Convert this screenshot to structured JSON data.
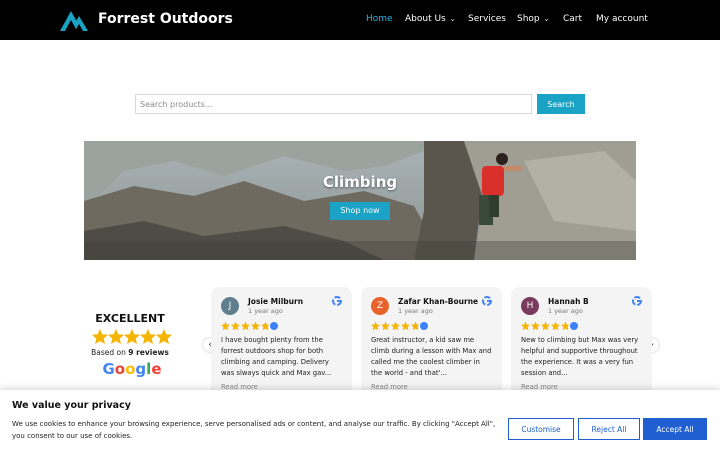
{
  "header": {
    "brand": "Forrest Outdoors",
    "nav": [
      {
        "label": "Home",
        "active": true,
        "dropdown": false
      },
      {
        "label": "About Us",
        "active": false,
        "dropdown": true
      },
      {
        "label": "Services",
        "active": false,
        "dropdown": false
      },
      {
        "label": "Shop",
        "active": false,
        "dropdown": true
      },
      {
        "label": "Cart",
        "active": false,
        "dropdown": false
      },
      {
        "label": "My account",
        "active": false,
        "dropdown": false
      }
    ]
  },
  "search": {
    "placeholder": "Search products...",
    "button_label": "Search"
  },
  "hero": {
    "title": "Climbing",
    "button_label": "Shop now"
  },
  "reviews_summary": {
    "rating_word": "EXCELLENT",
    "stars": 5,
    "based_on_prefix": "Based on",
    "review_count_label": "9 reviews",
    "provider": "Google"
  },
  "reviews": [
    {
      "name": "Josie Milburn",
      "initial": "J",
      "avatar_color": "#5f7f8f",
      "time": "1 year ago",
      "stars": 5,
      "text": "I have bought plenty from the forrest outdoors shop for both climbing and camping. Delivery was slways quick and Max gav...",
      "read_more": "Read more"
    },
    {
      "name": "Zafar Khan-Bourne",
      "initial": "Z",
      "avatar_color": "#e8622c",
      "time": "1 year ago",
      "stars": 5,
      "text": "Great instructor, a kid saw me climb during a lesson with Max and called me the coolest climber in the world - and that'...",
      "read_more": "Read more"
    },
    {
      "name": "Hannah B",
      "initial": "H",
      "avatar_color": "#7a3b5e",
      "time": "1 year ago",
      "stars": 5,
      "text": "New to climbing but Max was very helpful and supportive throughout the experience. It was a very fun session and...",
      "read_more": "Read more"
    }
  ],
  "cookie": {
    "title": "We value your privacy",
    "text": "We use cookies to enhance your browsing experience, serve personalised ads or content, and analyse our traffic. By clicking \"Accept All\", you consent to our use of cookies.",
    "customise": "Customise",
    "reject": "Reject All",
    "accept": "Accept All"
  },
  "colors": {
    "header_bg": "#000000",
    "active_nav": "#29aee6",
    "accent": "#1aa3c4",
    "star": "#f5b400",
    "cookie_button": "#1f5fd1"
  }
}
